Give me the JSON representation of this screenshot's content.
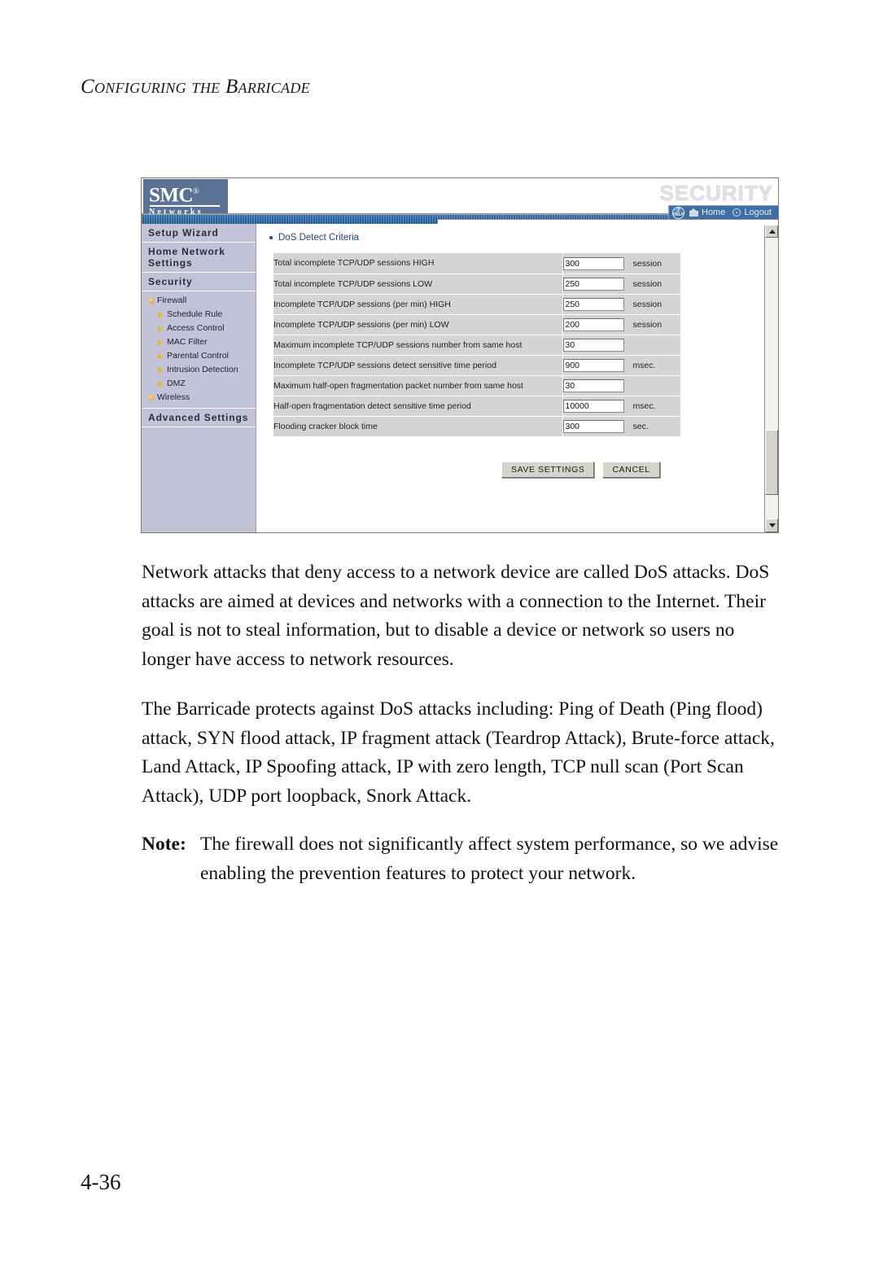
{
  "page": {
    "running_head": "Configuring the Barricade",
    "folio": "4-36"
  },
  "router_ui": {
    "logo": {
      "brand": "SMC",
      "registered_mark": "®",
      "tagline": "Networks"
    },
    "section_title": "SECURITY",
    "nav": {
      "help_label_top": "?",
      "help_label_bottom": "HELP",
      "items": [
        {
          "label": "Home",
          "icon": "home-icon"
        },
        {
          "label": "Logout",
          "icon": "logout-icon"
        }
      ]
    },
    "sidebar": {
      "headings": [
        "Setup Wizard",
        "Home Network Settings",
        "Security"
      ],
      "items": [
        {
          "label": "Firewall",
          "icon": "orange-dot-icon",
          "level": "top"
        },
        {
          "label": "Schedule Rule",
          "icon": "triangle-arrow-icon",
          "level": "sub"
        },
        {
          "label": "Access Control",
          "icon": "triangle-arrow-icon",
          "level": "sub"
        },
        {
          "label": "MAC Filter",
          "icon": "triangle-arrow-icon",
          "level": "sub"
        },
        {
          "label": "Parental Control",
          "icon": "triangle-arrow-icon",
          "level": "sub"
        },
        {
          "label": "Intrusion Detection",
          "icon": "triangle-arrow-icon",
          "level": "sub"
        },
        {
          "label": "DMZ",
          "icon": "triangle-arrow-icon",
          "level": "sub"
        },
        {
          "label": "Wireless",
          "icon": "orange-dot-icon",
          "level": "top"
        }
      ],
      "footer_heading": "Advanced Settings"
    },
    "content": {
      "heading": "DoS Detect Criteria",
      "rows": [
        {
          "label": "Total incomplete TCP/UDP sessions HIGH",
          "value": "300",
          "unit": "session"
        },
        {
          "label": "Total incomplete TCP/UDP sessions LOW",
          "value": "250",
          "unit": "session"
        },
        {
          "label": "Incomplete TCP/UDP sessions (per min) HIGH",
          "value": "250",
          "unit": "session"
        },
        {
          "label": "Incomplete TCP/UDP sessions (per min) LOW",
          "value": "200",
          "unit": "session"
        },
        {
          "label": "Maximum incomplete TCP/UDP sessions number from same host",
          "value": "30",
          "unit": ""
        },
        {
          "label": "Incomplete TCP/UDP sessions detect sensitive time period",
          "value": "900",
          "unit": "msec."
        },
        {
          "label": "Maximum half-open fragmentation packet number from same host",
          "value": "30",
          "unit": ""
        },
        {
          "label": "Half-open fragmentation detect sensitive time period",
          "value": "10000",
          "unit": "msec."
        },
        {
          "label": "Flooding cracker block time",
          "value": "300",
          "unit": "sec."
        }
      ],
      "buttons": {
        "save": "SAVE SETTINGS",
        "cancel": "CANCEL"
      }
    }
  },
  "body": {
    "paragraph_1": "Network attacks that deny access to a network device are called DoS attacks. DoS attacks are aimed at devices and networks with a connection to the Internet. Their goal is not to steal information, but to disable a device or network so users no longer have access to network resources.",
    "paragraph_2": "The Barricade protects against DoS attacks including: Ping of Death (Ping flood) attack, SYN flood attack, IP fragment attack (Teardrop Attack), Brute-force attack, Land Attack, IP Spoofing attack, IP with zero length, TCP null scan (Port Scan Attack), UDP port loopback, Snork Attack.",
    "note_label": "Note:",
    "note_text": "The firewall does not significantly affect system performance, so we advise enabling the prevention features to protect your network."
  },
  "colors": {
    "brand_blue": "#3f6ea5",
    "bar_blue": "#1d5790",
    "sidebar_bg": "#c2c3d6",
    "table_row": "#d4d4d4",
    "heading_blue": "#24456f",
    "accent_orange": "#f0b429"
  }
}
